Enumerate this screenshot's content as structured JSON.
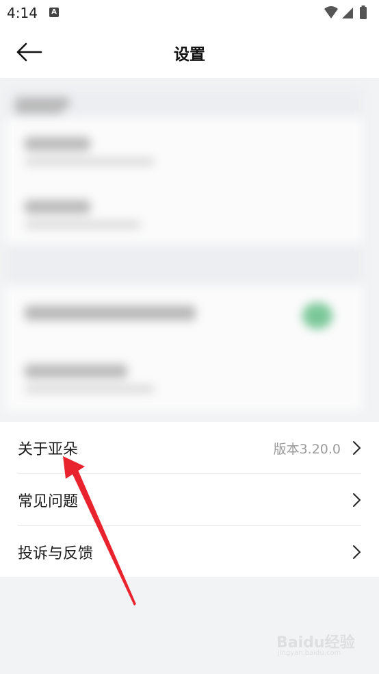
{
  "status_bar": {
    "time": "4:14",
    "app_icon_letter": "A",
    "icons": [
      "wifi-icon",
      "signal-icon",
      "battery-icon"
    ]
  },
  "header": {
    "title": "设置",
    "back_icon": "arrow-left-icon"
  },
  "settings_list": {
    "items": [
      {
        "label": "关于亚朵",
        "value": "版本3.20.0",
        "icon": "chevron-right-icon"
      },
      {
        "label": "常见问题",
        "value": "",
        "icon": "chevron-right-icon"
      },
      {
        "label": "投诉与反馈",
        "value": "",
        "icon": "chevron-right-icon"
      }
    ]
  },
  "watermark": {
    "text": "Baidu经验",
    "sub": "jingyan.baidu.com"
  },
  "colors": {
    "background": "#f2f3f5",
    "card": "#ffffff",
    "annotation_arrow": "#e8232d",
    "secondary_text": "#9a9a9a"
  }
}
